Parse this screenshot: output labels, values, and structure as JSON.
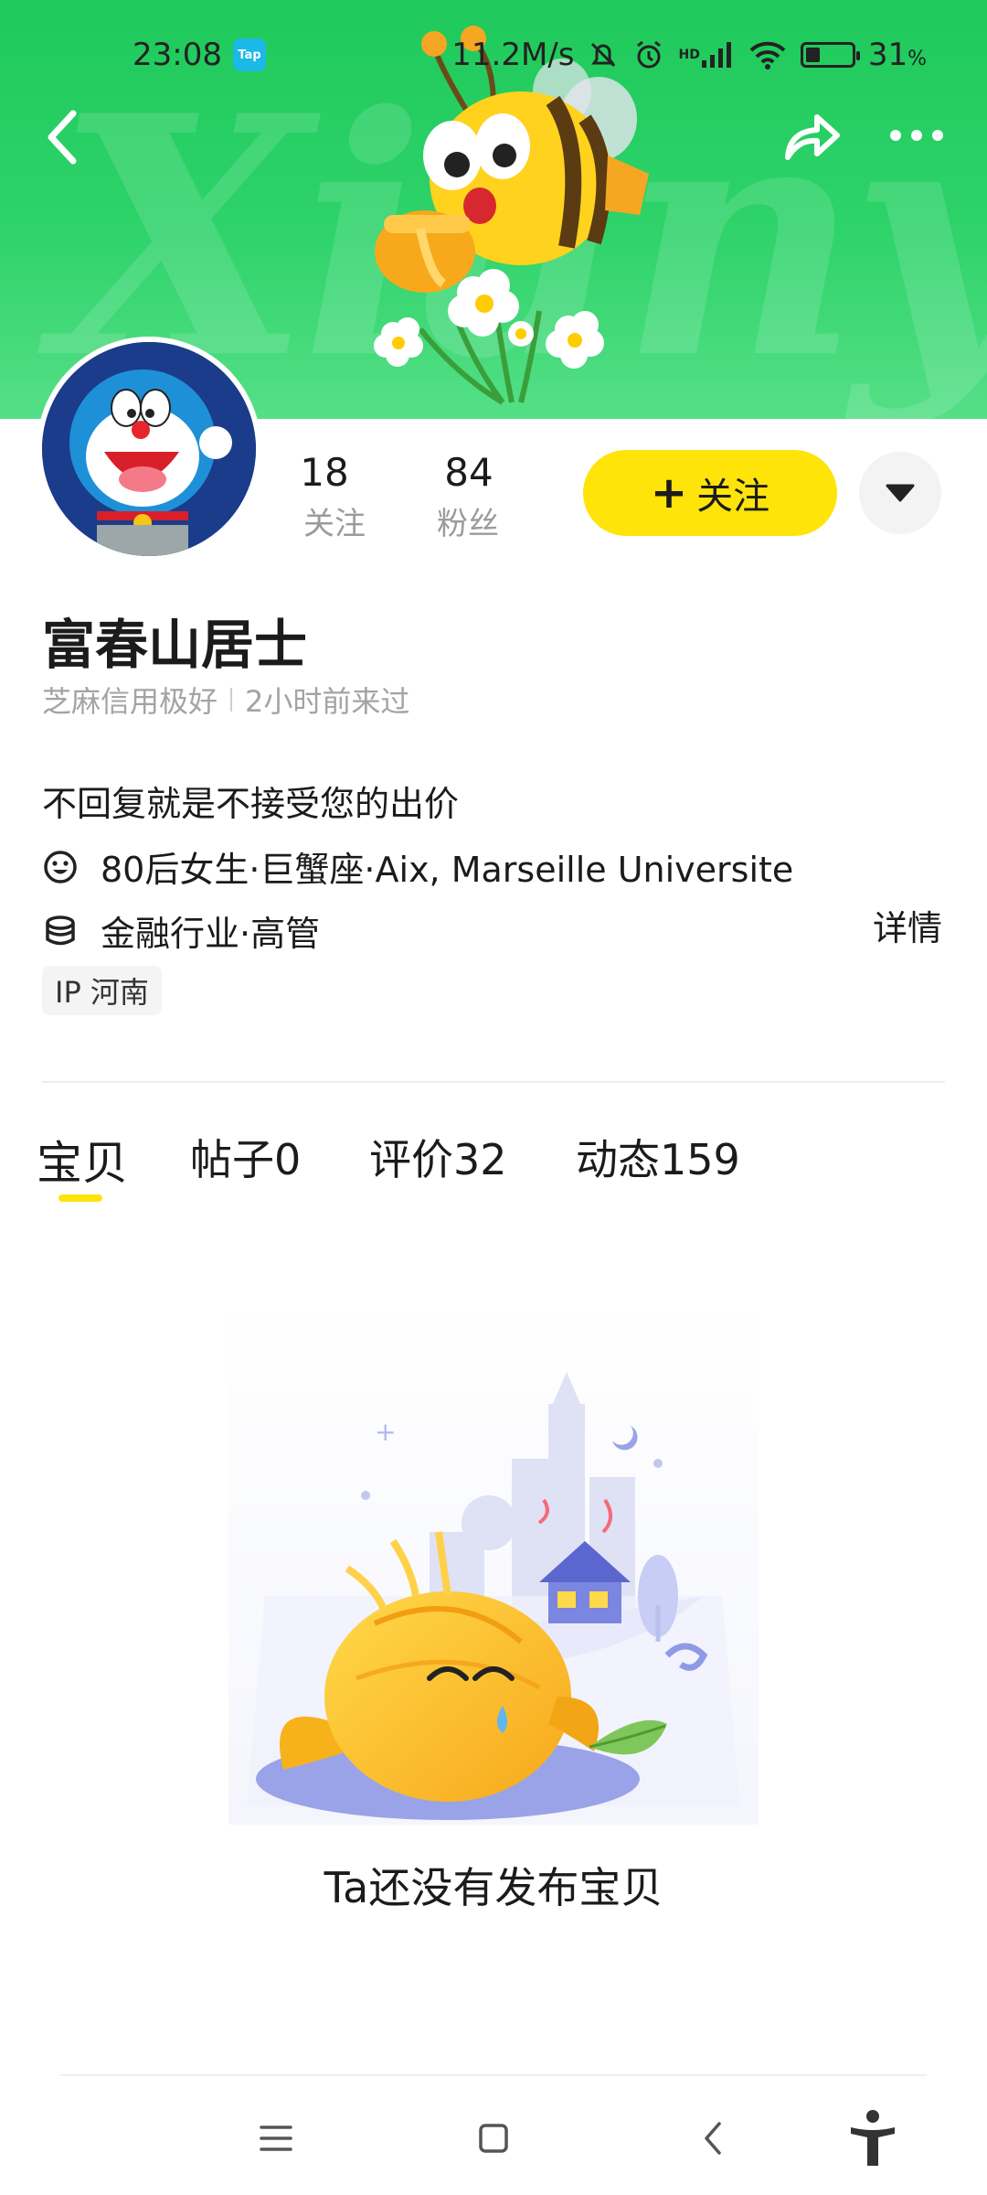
{
  "status_bar": {
    "time": "23:08",
    "tap_badge": "Tap",
    "network_speed": "11.2M/s",
    "hd_label": "HD",
    "battery": "31",
    "battery_unit": "%",
    "battery_level": 0.31
  },
  "banner": {
    "watermark": "Xianyu",
    "background_color": "#2ed36a"
  },
  "profile": {
    "follow_count": "18",
    "follow_label": "关注",
    "fans_count": "84",
    "fans_label": "粉丝",
    "follow_button_label": "关注",
    "name": "富春山居士",
    "credit": "芝麻信用极好",
    "last_seen": "2小时前来过",
    "bio": "不回复就是不接受您的出价",
    "info_personal": "80后女生·巨蟹座·Aix, Marseille Universite",
    "info_job": "金融行业·高管",
    "details_label": "详情",
    "ip_label": "IP 河南",
    "accent_color": "#ffe40a"
  },
  "tabs": [
    {
      "label": "宝贝"
    },
    {
      "label": "帖子0"
    },
    {
      "label": "评价32"
    },
    {
      "label": "动态159"
    }
  ],
  "empty_state": {
    "text": "Ta还没有发布宝贝"
  }
}
